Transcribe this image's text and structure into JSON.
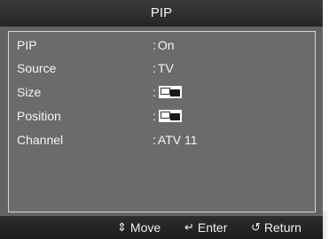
{
  "title": "PIP",
  "colon": ":",
  "rows": [
    {
      "label": "PIP",
      "value": "On",
      "type": "text"
    },
    {
      "label": "Source",
      "value": "TV",
      "type": "text"
    },
    {
      "label": "Size",
      "type": "icon",
      "icon": "pip-size-icon"
    },
    {
      "label": "Position",
      "type": "icon",
      "icon": "pip-position-icon"
    },
    {
      "label": "Channel",
      "value": "ATV 11",
      "type": "text"
    }
  ],
  "footer": {
    "move": {
      "icon": "up-down-arrows-icon",
      "glyph": "⇕",
      "label": "Move"
    },
    "enter": {
      "icon": "enter-icon",
      "glyph": "↵",
      "label": "Enter"
    },
    "return": {
      "icon": "return-icon",
      "glyph": "↺",
      "label": "Return"
    }
  }
}
